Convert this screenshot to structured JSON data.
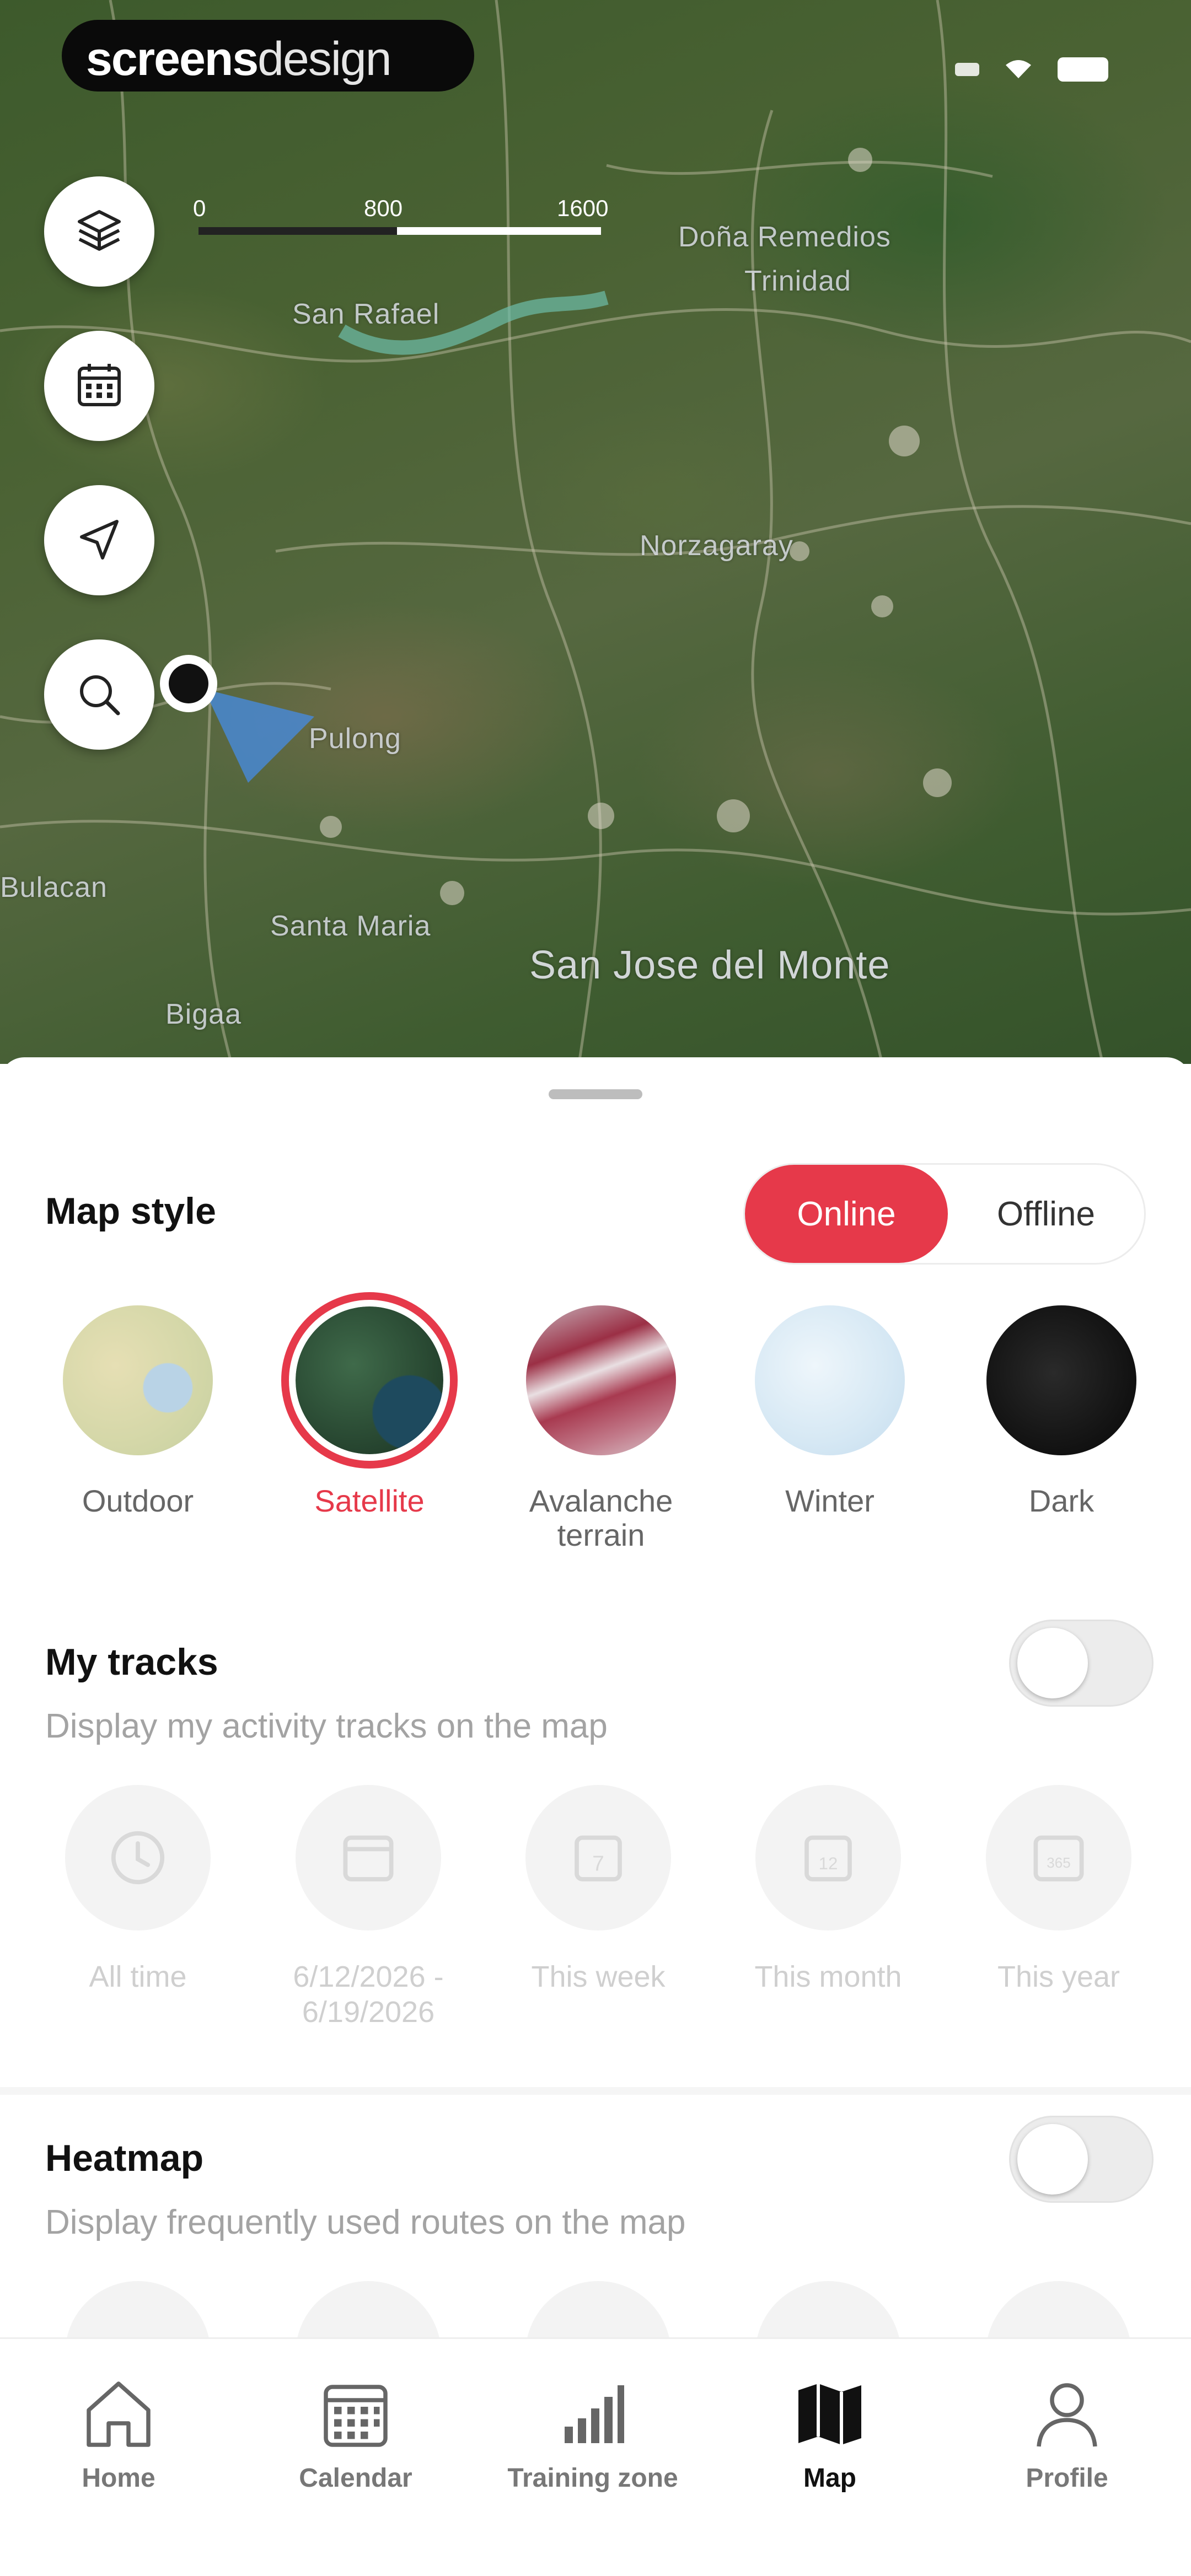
{
  "watermark": {
    "brand_bold": "screens",
    "brand_light": "design"
  },
  "map": {
    "scale": {
      "mid_label": "800",
      "end_label": "1600"
    },
    "places": {
      "dona_remedios": "Doña Remedios",
      "trinidad": "Trinidad",
      "san_rafael": "San Rafael",
      "norzagaray": "Norzagaray",
      "pulong": "Pulong",
      "santa_maria": "Santa Maria",
      "san_jose": "San Jose del Monte",
      "bulacan": "Bulacan",
      "bigaa": "Bigaa"
    },
    "controls": [
      {
        "name": "layers-icon"
      },
      {
        "name": "calendar-icon"
      },
      {
        "name": "locate-arrow-icon"
      },
      {
        "name": "search-icon"
      }
    ]
  },
  "sheet": {
    "map_style": {
      "title": "Map style",
      "online_label": "Online",
      "offline_label": "Offline",
      "selected": "Satellite",
      "styles": [
        {
          "label": "Outdoor"
        },
        {
          "label": "Satellite"
        },
        {
          "label": "Avalanche terrain"
        },
        {
          "label": "Winter"
        },
        {
          "label": "Dark"
        }
      ]
    },
    "my_tracks": {
      "title": "My tracks",
      "subtitle": "Display my activity tracks on the map",
      "enabled": false,
      "periods": [
        {
          "label": "All time",
          "icon": "clock-icon"
        },
        {
          "label": "6/12/2026 - 6/19/2026",
          "icon": "date-range-icon"
        },
        {
          "label": "This week",
          "icon": "calendar-7-icon"
        },
        {
          "label": "This month",
          "icon": "calendar-12-icon"
        },
        {
          "label": "This year",
          "icon": "calendar-365-icon"
        }
      ],
      "icon_texts": {
        "week": "7",
        "month": "12",
        "year": "365"
      }
    },
    "heatmap": {
      "title": "Heatmap",
      "subtitle": "Display frequently used routes on the map",
      "enabled": false
    }
  },
  "tabbar": {
    "active": "Map",
    "items": [
      {
        "label": "Home",
        "icon": "home-icon"
      },
      {
        "label": "Calendar",
        "icon": "calendar-grid-icon"
      },
      {
        "label": "Training zone",
        "icon": "bar-chart-icon"
      },
      {
        "label": "Map",
        "icon": "map-icon"
      },
      {
        "label": "Profile",
        "icon": "profile-icon"
      }
    ]
  },
  "colors": {
    "accent": "#e6394a",
    "muted_text": "#a3a3a3"
  }
}
